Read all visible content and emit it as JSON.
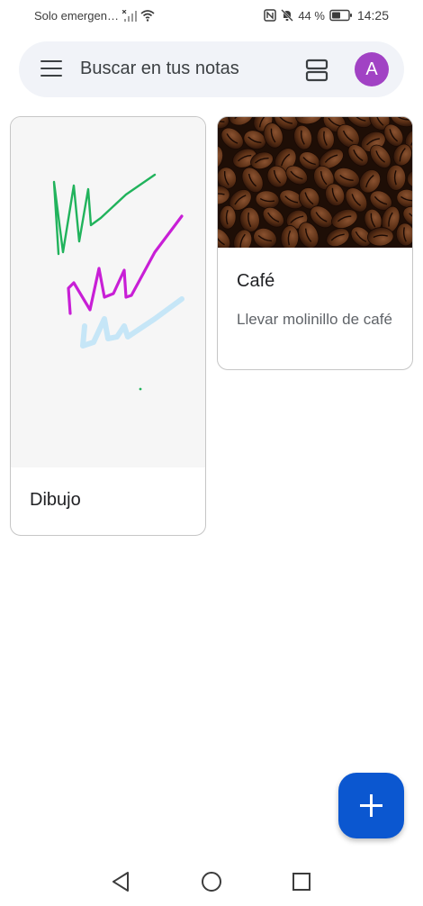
{
  "status_bar": {
    "carrier": "Solo emergen…",
    "battery": "44 %",
    "time": "14:25",
    "icons": [
      "no-sim-signal-icon",
      "wifi-icon",
      "nfc-icon",
      "mute-bell-icon",
      "battery-icon"
    ]
  },
  "search": {
    "placeholder": "Buscar en tus notas",
    "avatar_letter": "A",
    "avatar_color": "#a142c4"
  },
  "notes": [
    {
      "type": "drawing",
      "title": "Dibujo",
      "stroke_colors": [
        "#21b35c",
        "#c81fd6",
        "#c6e6f7"
      ]
    },
    {
      "type": "image",
      "image": "coffee-beans",
      "title": "Café",
      "body": "Llevar molinillo de café"
    }
  ],
  "fab": {
    "icon": "plus-icon",
    "color": "#0b57d0"
  },
  "nav": {
    "icons": [
      "back-icon",
      "home-icon",
      "recents-icon"
    ]
  }
}
